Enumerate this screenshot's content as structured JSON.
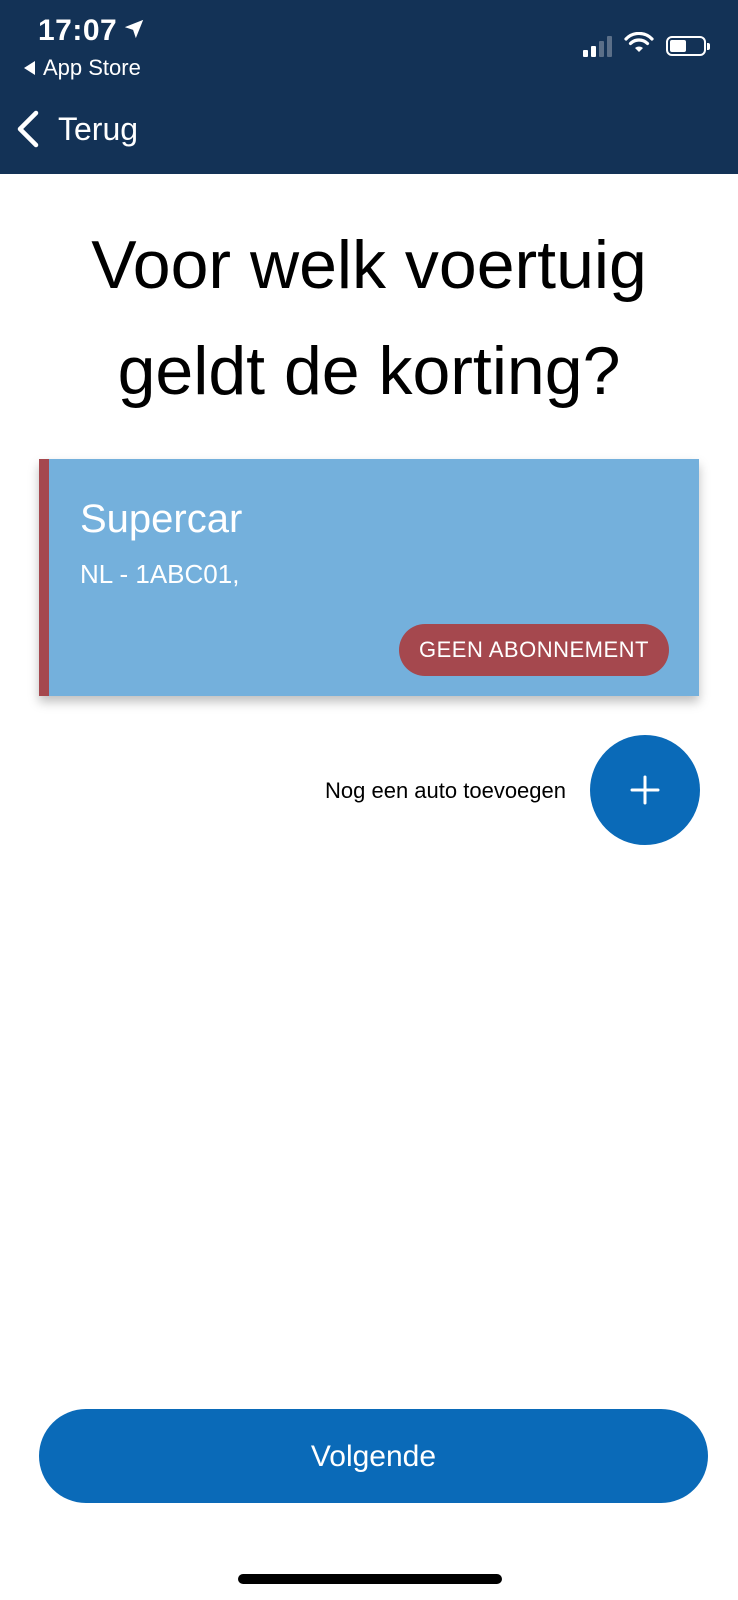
{
  "status_bar": {
    "time": "17:07",
    "back_app": "App Store"
  },
  "nav": {
    "back_label": "Terug"
  },
  "page": {
    "title_line1": "Voor welk voertuig",
    "title_line2": "geldt de korting?"
  },
  "vehicle": {
    "name": "Supercar",
    "plate": "NL - 1ABC01,",
    "badge": "GEEN ABONNEMENT"
  },
  "add_vehicle": {
    "label": "Nog een auto toevoegen"
  },
  "footer": {
    "next_label": "Volgende"
  },
  "colors": {
    "header_bg": "#133256",
    "card_bg": "#74b0dc",
    "card_accent": "#a5484e",
    "primary": "#0a6ab8"
  }
}
